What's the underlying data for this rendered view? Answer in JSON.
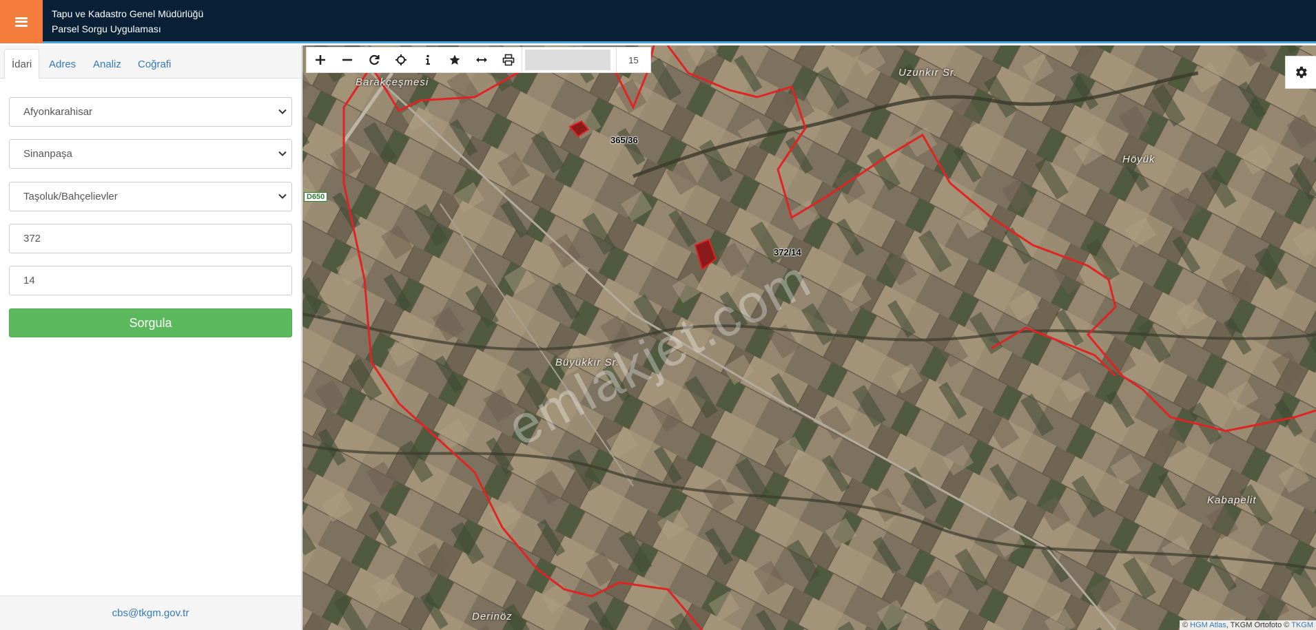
{
  "header": {
    "title_line1": "Tapu ve Kadastro Genel Müdürlüğü",
    "title_line2": "Parsel Sorgu Uygulaması"
  },
  "sidebar": {
    "tabs": [
      {
        "label": "İdari",
        "active": true
      },
      {
        "label": "Adres",
        "active": false
      },
      {
        "label": "Analiz",
        "active": false
      },
      {
        "label": "Coğrafi",
        "active": false
      }
    ],
    "province": "Afyonkarahisar",
    "district": "Sinanpaşa",
    "neighborhood": "Taşoluk/Bahçelievler",
    "block_no": "372",
    "parcel_no": "14",
    "query_button": "Sorgula",
    "footer_email": "cbs@tkgm.gov.tr"
  },
  "toolbar": {
    "tools": [
      "zoom-in-icon",
      "zoom-out-icon",
      "refresh-icon",
      "locate-icon",
      "info-icon",
      "star-icon",
      "measure-icon",
      "print-icon"
    ],
    "zoom_level": "15"
  },
  "map": {
    "place_labels": {
      "barakcesmesi": "Barakçeşmesi",
      "uzunkir": "Uzunkır Sr.",
      "hoyuk": "Höyük",
      "buyukkir": "Büyükkır Sr.",
      "kabapelit": "Kabapelit",
      "derinoz": "Derinöz"
    },
    "road_label": "D650",
    "parcels": {
      "parcel1": "365/36",
      "parcel2": "372/14"
    },
    "watermark": "emlakjet.com",
    "attribution": {
      "prefix": "© ",
      "hgm": "HGM Atlas",
      "middle": ", TKGM Ortofoto © ",
      "tkgm": "TKGM"
    },
    "colors": {
      "boundary": "#e02424",
      "parcel_fill": "#8b1a1a"
    }
  }
}
